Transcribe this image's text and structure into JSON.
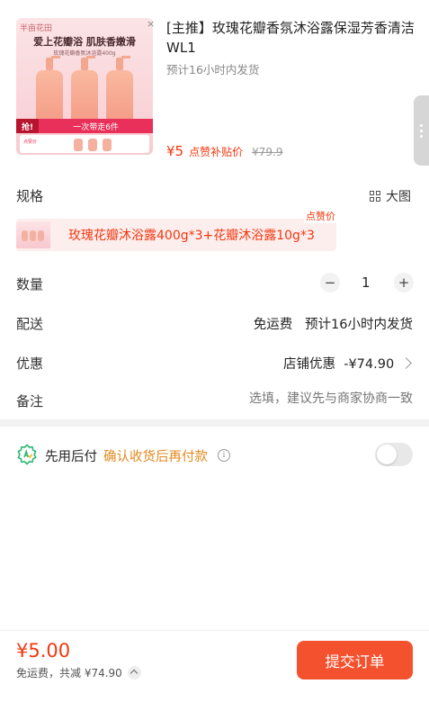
{
  "product": {
    "image": {
      "brand": "半亩花田",
      "heading": "爱上花瓣浴 肌肤香嫩滑",
      "sub": "玫瑰花瓣香氛沐浴露400g",
      "banner_left": "抢!",
      "banner_right": "一次带走6件",
      "strip_tag": "点赞价"
    },
    "close": "×",
    "title": "[主推】玫瑰花瓣香氛沐浴露保湿芳香清洁WL1",
    "shipping_eta": "预计16小时内发货",
    "price": "¥5",
    "price_tag": "点赞补贴价",
    "original_price": "¥79.9"
  },
  "spec": {
    "label": "规格",
    "view_big": "大图",
    "option": "玫瑰花瓣沐浴露400g*3+花瓣沐浴露10g*3",
    "badge": "点赞价"
  },
  "quantity": {
    "label": "数量",
    "minus": "−",
    "value": "1",
    "plus": "+"
  },
  "delivery": {
    "label": "配送",
    "value": "免运费   预计16小时内发货"
  },
  "promo": {
    "label": "优惠",
    "value": "店铺优惠  -¥74.90"
  },
  "note": {
    "label": "备注",
    "placeholder": "选填，建议先与商家协商一致"
  },
  "pay_later": {
    "label": "先用后付",
    "desc": "确认收货后再付款",
    "info": "i",
    "enabled": false
  },
  "footer": {
    "total": "¥5.00",
    "sub": "免运费，共减 ¥74.90",
    "submit": "提交订单"
  },
  "colors": {
    "accent": "#f2370f",
    "button": "#f4512e",
    "pay_later_text": "#e28a1f"
  }
}
